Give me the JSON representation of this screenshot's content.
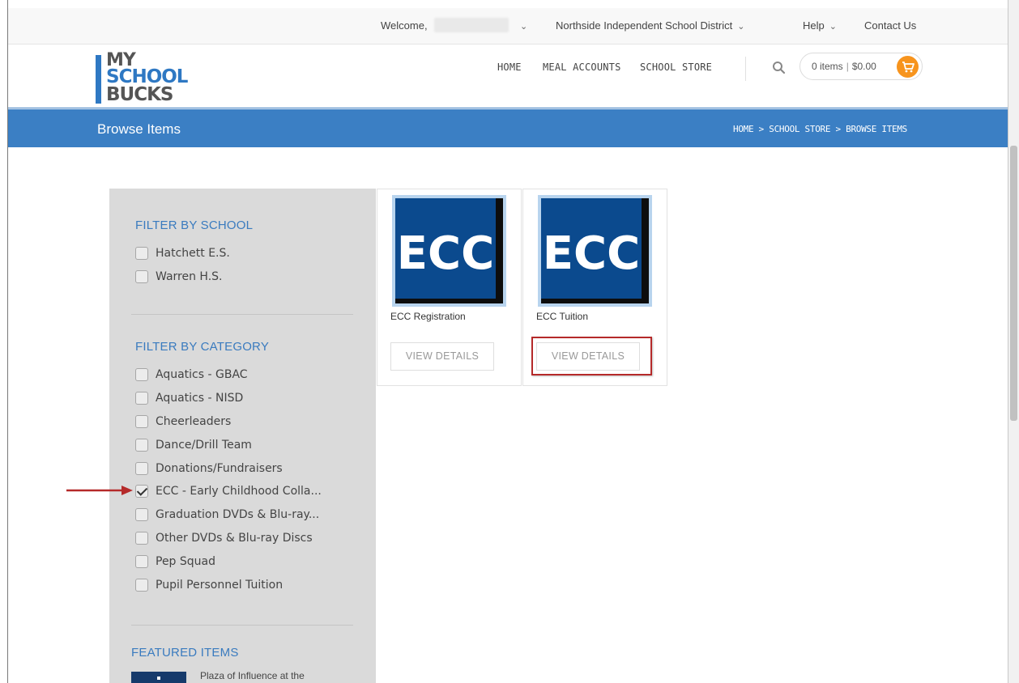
{
  "topbar": {
    "welcome": "Welcome,",
    "district": "Northside Independent School District",
    "help": "Help",
    "contact": "Contact Us"
  },
  "logo": {
    "line1": "MY",
    "line2": "SCHOOL",
    "line3": "BUCKS"
  },
  "nav": {
    "home": "HOME",
    "meal_accounts": "MEAL ACCOUNTS",
    "school_store": "SCHOOL STORE"
  },
  "cart": {
    "items": "0 items",
    "total": "$0.00"
  },
  "page": {
    "title": "Browse Items",
    "breadcrumb": "HOME > SCHOOL STORE > BROWSE ITEMS"
  },
  "sidebar": {
    "school_title": "FILTER BY SCHOOL",
    "schools": [
      {
        "label": "Hatchett E.S.",
        "checked": false
      },
      {
        "label": "Warren H.S.",
        "checked": false
      }
    ],
    "category_title": "FILTER BY CATEGORY",
    "categories": [
      {
        "label": "Aquatics - GBAC",
        "checked": false
      },
      {
        "label": "Aquatics - NISD",
        "checked": false
      },
      {
        "label": "Cheerleaders",
        "checked": false
      },
      {
        "label": "Dance/Drill Team",
        "checked": false
      },
      {
        "label": "Donations/Fundraisers",
        "checked": false
      },
      {
        "label": "ECC - Early Childhood Colla...",
        "checked": true
      },
      {
        "label": "Graduation DVDs & Blu-ray...",
        "checked": false
      },
      {
        "label": "Other DVDs & Blu-ray Discs",
        "checked": false
      },
      {
        "label": "Pep Squad",
        "checked": false
      },
      {
        "label": "Pupil Personnel Tuition",
        "checked": false
      }
    ],
    "featured_title": "FEATURED ITEMS",
    "featured_item": "Plaza of Influence at the"
  },
  "products": [
    {
      "name": "ECC Registration",
      "image_text": "ECC",
      "button": "VIEW DETAILS"
    },
    {
      "name": "ECC Tuition",
      "image_text": "ECC",
      "button": "VIEW DETAILS"
    }
  ],
  "colors": {
    "brand_blue": "#3b7fc4",
    "cart_orange": "#f7941d",
    "annotation_red": "#b52a2a",
    "ecc_navy": "#0b4a8e"
  }
}
